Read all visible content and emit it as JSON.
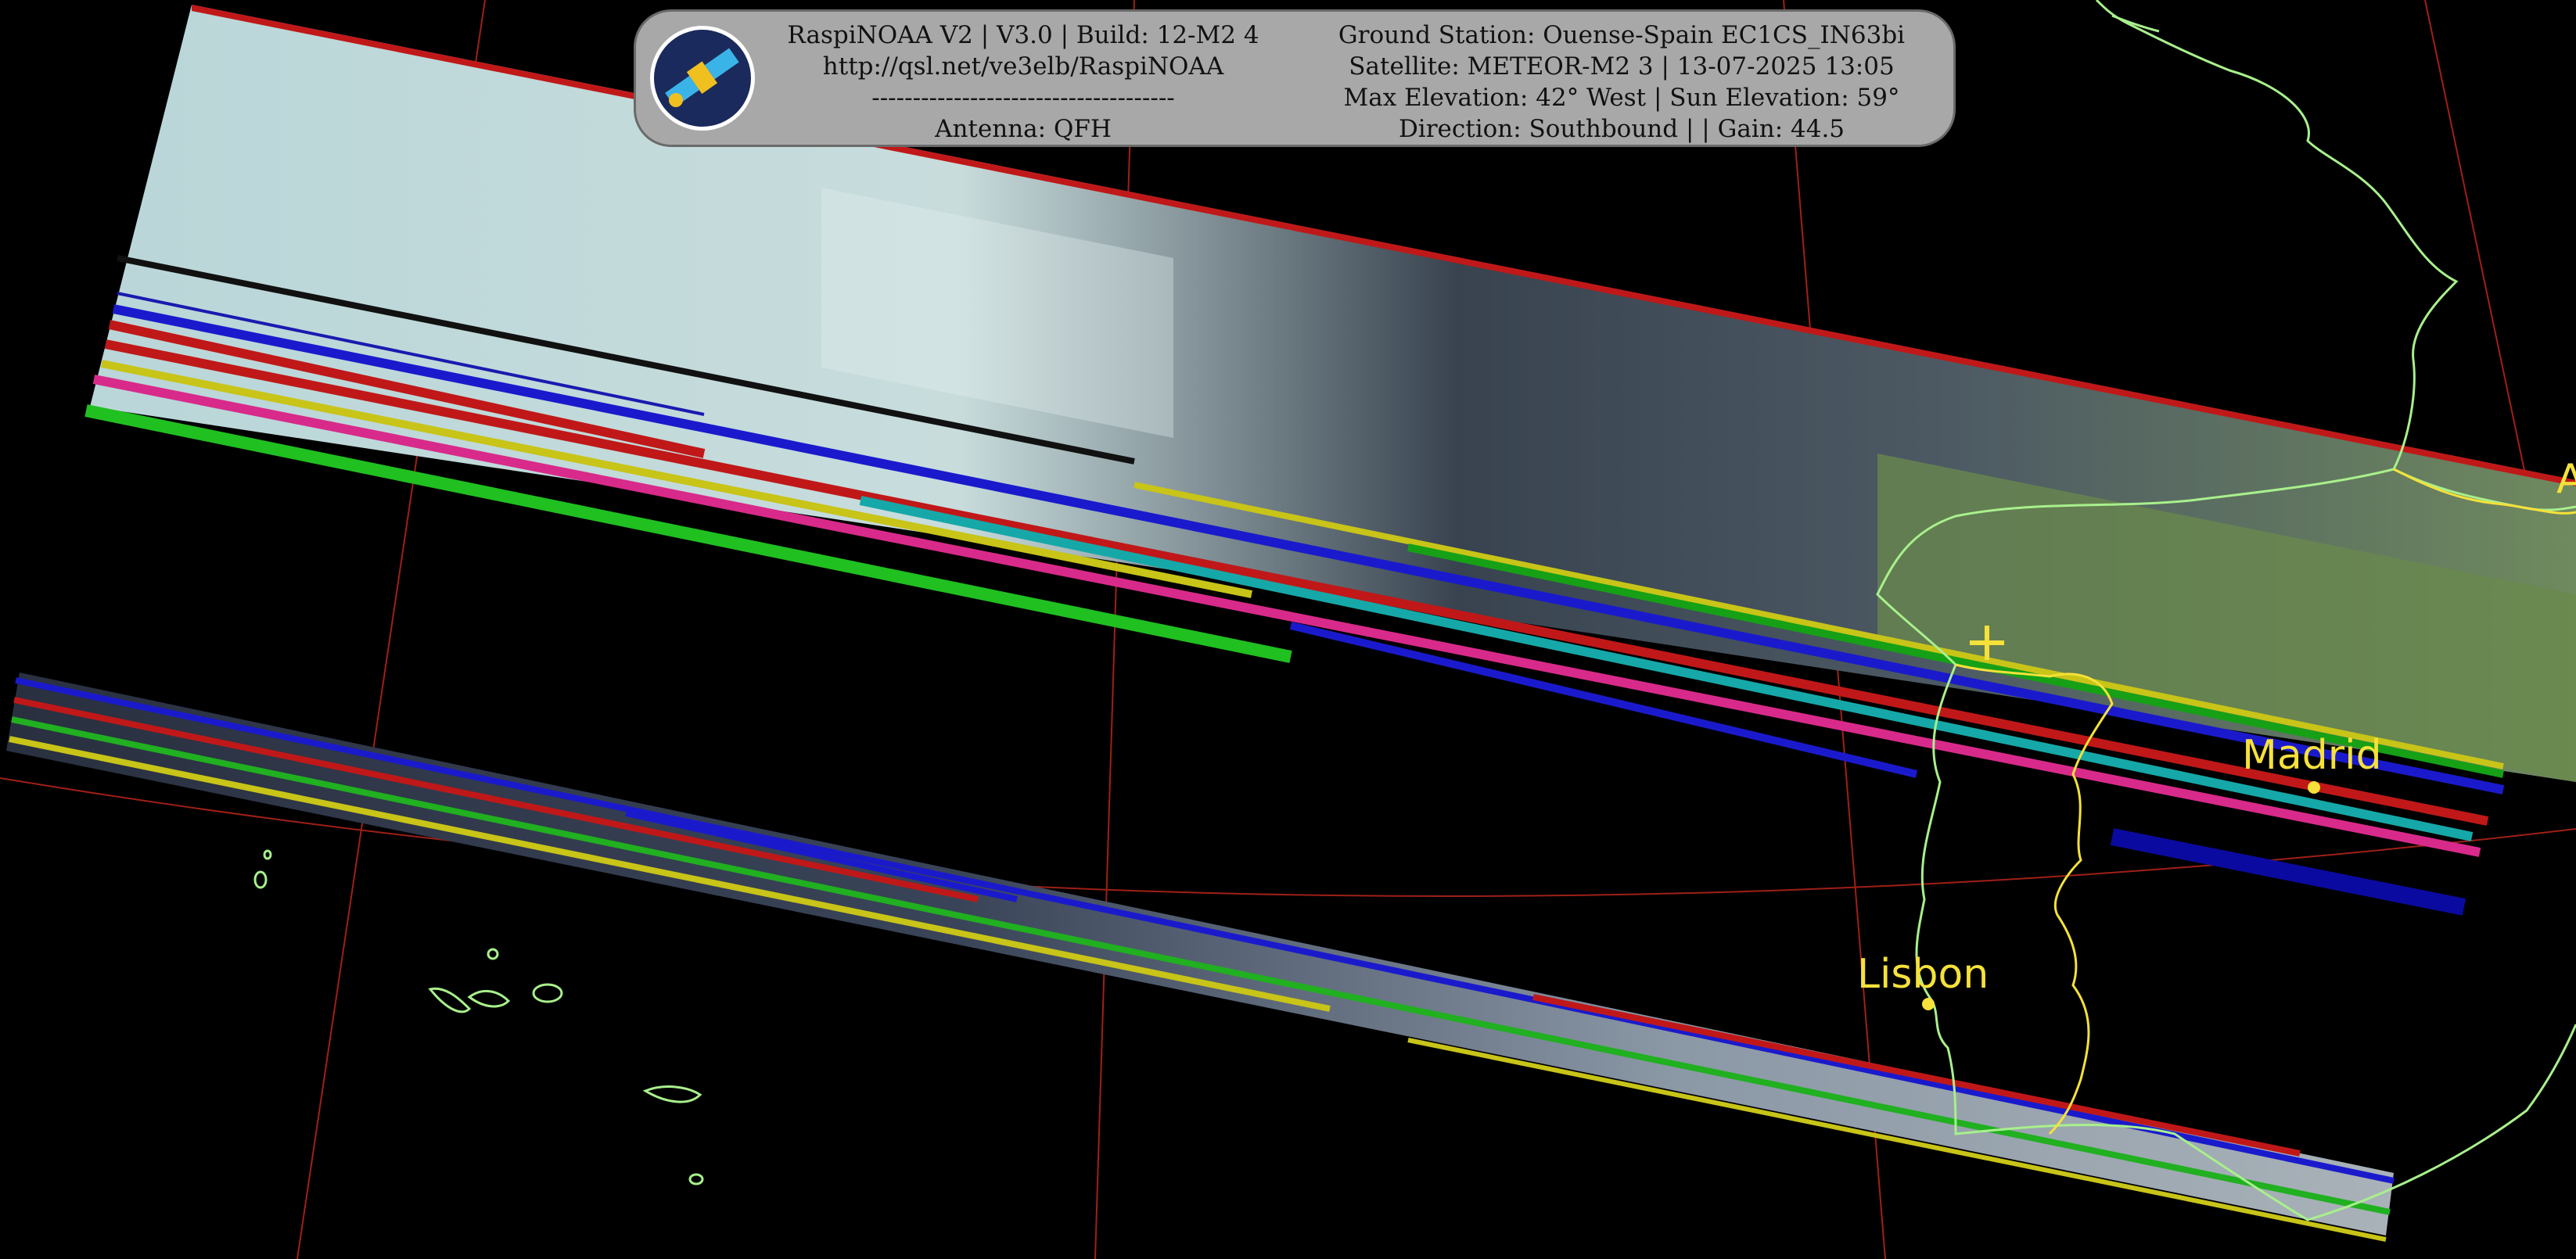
{
  "header": {
    "left_lines": [
      "RaspiNOAA V2 | V3.0 | Build: 12-M2 4",
      "http://qsl.net/ve3elb/RaspiNOAA",
      "-------------------------------------",
      "Antenna: QFH"
    ],
    "right_lines": [
      "Ground Station: Ouense-Spain EC1CS_IN63bi",
      "Satellite: METEOR-M2 3 | 13-07-2025 13:05",
      "Max Elevation: 42° West | Sun Elevation: 59°",
      "Direction: Southbound | | Gain: 44.5"
    ],
    "logo_icon": "satellite-icon"
  },
  "map": {
    "cities": [
      {
        "name": "Madrid"
      },
      {
        "name": "Lisbon"
      }
    ],
    "edge_label_fragment": "A",
    "marker_icon": "ground-station-cross-icon",
    "colors": {
      "background": "#000000",
      "coastline": "#a8f08c",
      "border": "#f5e13a",
      "graticule": "#b02418",
      "labels": "#f5e13a",
      "info_box": "#a8a8a8"
    }
  }
}
